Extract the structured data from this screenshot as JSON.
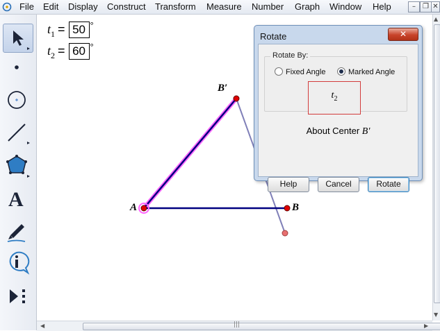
{
  "menu": {
    "items": [
      "File",
      "Edit",
      "Display",
      "Construct",
      "Transform",
      "Measure",
      "Number",
      "Graph",
      "Window",
      "Help"
    ]
  },
  "window_controls": {
    "minimize": "–",
    "restore": "❐",
    "close": "✕"
  },
  "toolbox": {
    "tools": [
      "select-arrow-icon",
      "point-icon",
      "compass-icon",
      "straightedge-icon",
      "polygon-icon",
      "text-icon",
      "marker-icon",
      "information-icon",
      "custom-tool-icon"
    ]
  },
  "parameters": [
    {
      "name": "t",
      "sub": "1",
      "eq": "=",
      "value": "50",
      "unit": "°"
    },
    {
      "name": "t",
      "sub": "2",
      "eq": "=",
      "value": "60",
      "unit": "°"
    }
  ],
  "points": {
    "A": "A",
    "B": "B",
    "B_prime": "B′"
  },
  "colors": {
    "segment": "#000080",
    "highlight": "#ff66ff",
    "point": "#e00000",
    "rotated": "#8080b8"
  },
  "dialog": {
    "title": "Rotate",
    "close_label": "✕",
    "group_label": "Rotate By:",
    "fixed_angle_label": "Fixed Angle",
    "marked_angle_label": "Marked Angle",
    "selected_option": "Marked Angle",
    "angle_name": "t",
    "angle_sub": "2",
    "about_text": "About Center ",
    "about_center": "B′",
    "help_label": "Help",
    "cancel_label": "Cancel",
    "rotate_label": "Rotate"
  },
  "scroll": {
    "h_thumb_grip": "|||",
    "v_up": "▲",
    "v_down": "▼",
    "h_left": "◀",
    "h_right": "▶"
  }
}
